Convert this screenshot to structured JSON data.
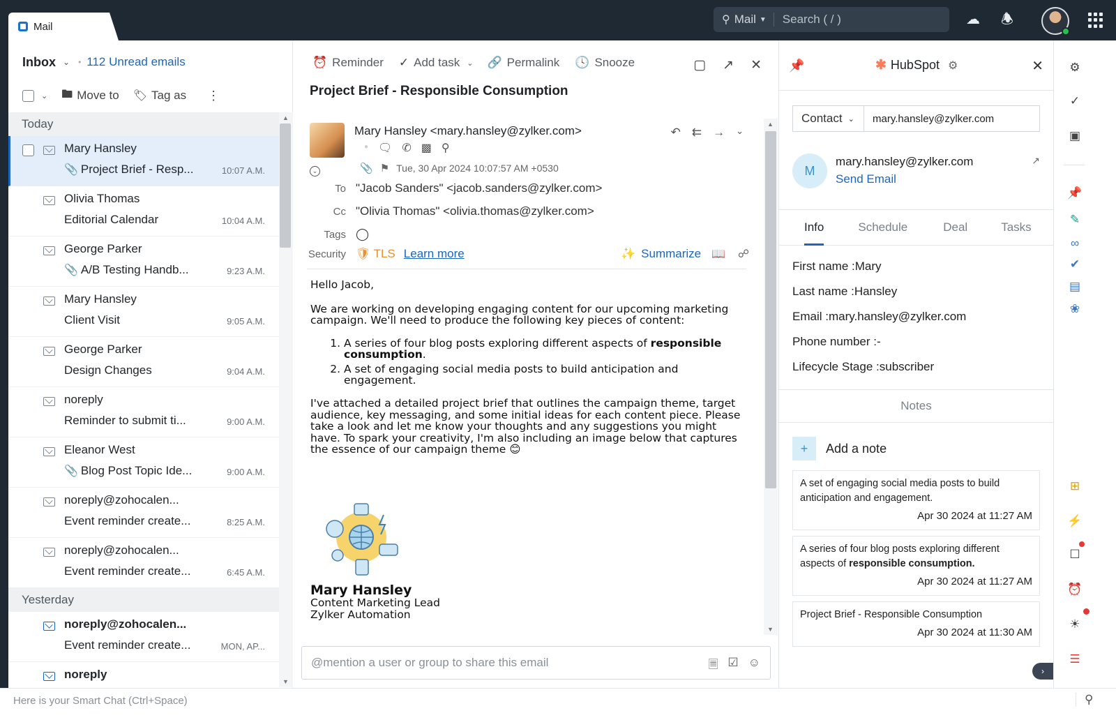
{
  "topbar": {
    "tab_label": "Mail",
    "search_scope": "Mail",
    "search_placeholder": "Search ( / )"
  },
  "list": {
    "folder": "Inbox",
    "unread": "112 Unread emails",
    "toolbar": {
      "move_to": "Move to",
      "tag_as": "Tag as"
    },
    "groups": [
      {
        "label": "Today",
        "items": [
          {
            "sender": "Mary Hansley",
            "subject": "Project Brief - Resp...",
            "time": "10:07 A.M.",
            "attachment": true
          },
          {
            "sender": "Olivia Thomas",
            "subject": "Editorial Calendar",
            "time": "10:04 A.M.",
            "attachment": false
          },
          {
            "sender": "George Parker",
            "subject": "A/B Testing Handb...",
            "time": "9:23 A.M.",
            "attachment": true
          },
          {
            "sender": "Mary Hansley",
            "subject": "Client Visit",
            "time": "9:05 A.M.",
            "attachment": false
          },
          {
            "sender": "George Parker",
            "subject": "Design Changes",
            "time": "9:04 A.M.",
            "attachment": false
          },
          {
            "sender": "noreply",
            "subject": "Reminder to submit ti...",
            "time": "9:00 A.M.",
            "attachment": false
          },
          {
            "sender": "Eleanor West",
            "subject": "Blog Post Topic Ide...",
            "time": "9:00 A.M.",
            "attachment": true
          },
          {
            "sender": "noreply@zohocalen...",
            "subject": "Event reminder create...",
            "time": "8:25 A.M.",
            "attachment": false
          },
          {
            "sender": "noreply@zohocalen...",
            "subject": "Event reminder create...",
            "time": "6:45 A.M.",
            "attachment": false
          }
        ]
      },
      {
        "label": "Yesterday",
        "items": [
          {
            "sender": "noreply@zohocalen...",
            "subject": "Event reminder create...",
            "time": "MON, AP...",
            "attachment": false,
            "unread": true
          },
          {
            "sender": "noreply",
            "subject": "",
            "time": "",
            "attachment": false,
            "unread": true
          }
        ]
      }
    ]
  },
  "message": {
    "actions": {
      "reminder": "Reminder",
      "add_task": "Add task",
      "permalink": "Permalink",
      "snooze": "Snooze"
    },
    "subject": "Project Brief - Responsible Consumption",
    "from": "Mary Hansley <mary.hansley@zylker.com>",
    "date": "Tue, 30 Apr 2024 10:07:57 AM +0530",
    "to_label": "To",
    "to": "\"Jacob Sanders\" <jacob.sanders@zylker.com>",
    "cc_label": "Cc",
    "cc": "\"Olivia Thomas\" <olivia.thomas@zylker.com>",
    "tags_label": "Tags",
    "security_label": "Security",
    "tls": "TLS",
    "learn_more": "Learn more",
    "summarize": "Summarize",
    "body": {
      "greeting": "Hello Jacob,",
      "intro": "We are working on developing engaging content for our upcoming marketing campaign. We'll need to produce the following key pieces of content:",
      "item1_pre": "A series of four blog posts exploring different aspects of ",
      "item1_bold": "responsible consumption",
      "item1_post": ".",
      "item2": "A set of engaging social media posts to build anticipation and engagement.",
      "closing": "I've attached a detailed project brief that outlines the campaign theme, target audience, key messaging, and some initial ideas for each content piece. Please take a look and let me know your thoughts and any suggestions you might have. To spark your creativity, I'm also including an image below that captures the essence of our campaign theme 😊"
    },
    "signature": {
      "name": "Mary Hansley",
      "title": "Content Marketing Lead",
      "company": "Zylker Automation"
    },
    "share_placeholder": "@mention a user or group to share this email"
  },
  "hubspot": {
    "title": "HubSpot",
    "search_type": "Contact",
    "search_value": "mary.hansley@zylker.com",
    "avatar_letter": "M",
    "contact_email": "mary.hansley@zylker.com",
    "send_email": "Send Email",
    "tabs": [
      "Info",
      "Schedule",
      "Deal",
      "Tasks"
    ],
    "info": {
      "first_name": "First name :Mary",
      "last_name": "Last name :Hansley",
      "email": "Email :mary.hansley@zylker.com",
      "phone": "Phone number :-",
      "lifecycle": "Lifecycle Stage :subscriber"
    },
    "notes_label": "Notes",
    "add_note": "Add a note",
    "notes": [
      {
        "text": "A set of engaging social media posts to build anticipation and engagement.",
        "date": "Apr 30 2024 at 11:27 AM"
      },
      {
        "text_pre": "A series of four blog posts exploring different aspects of ",
        "text_bold": "responsible consumption.",
        "date": "Apr 30 2024 at 11:27 AM"
      },
      {
        "text": "Project Brief - Responsible Consumption",
        "date": "Apr 30 2024 at 11:30 AM"
      }
    ]
  },
  "smartchat": {
    "placeholder": "Here is your Smart Chat (Ctrl+Space)"
  },
  "colors": {
    "topbar": "#1f2933",
    "accent": "#1a66c2",
    "hubspot_orange": "#ff7a59",
    "tls_orange": "#e8912f"
  }
}
